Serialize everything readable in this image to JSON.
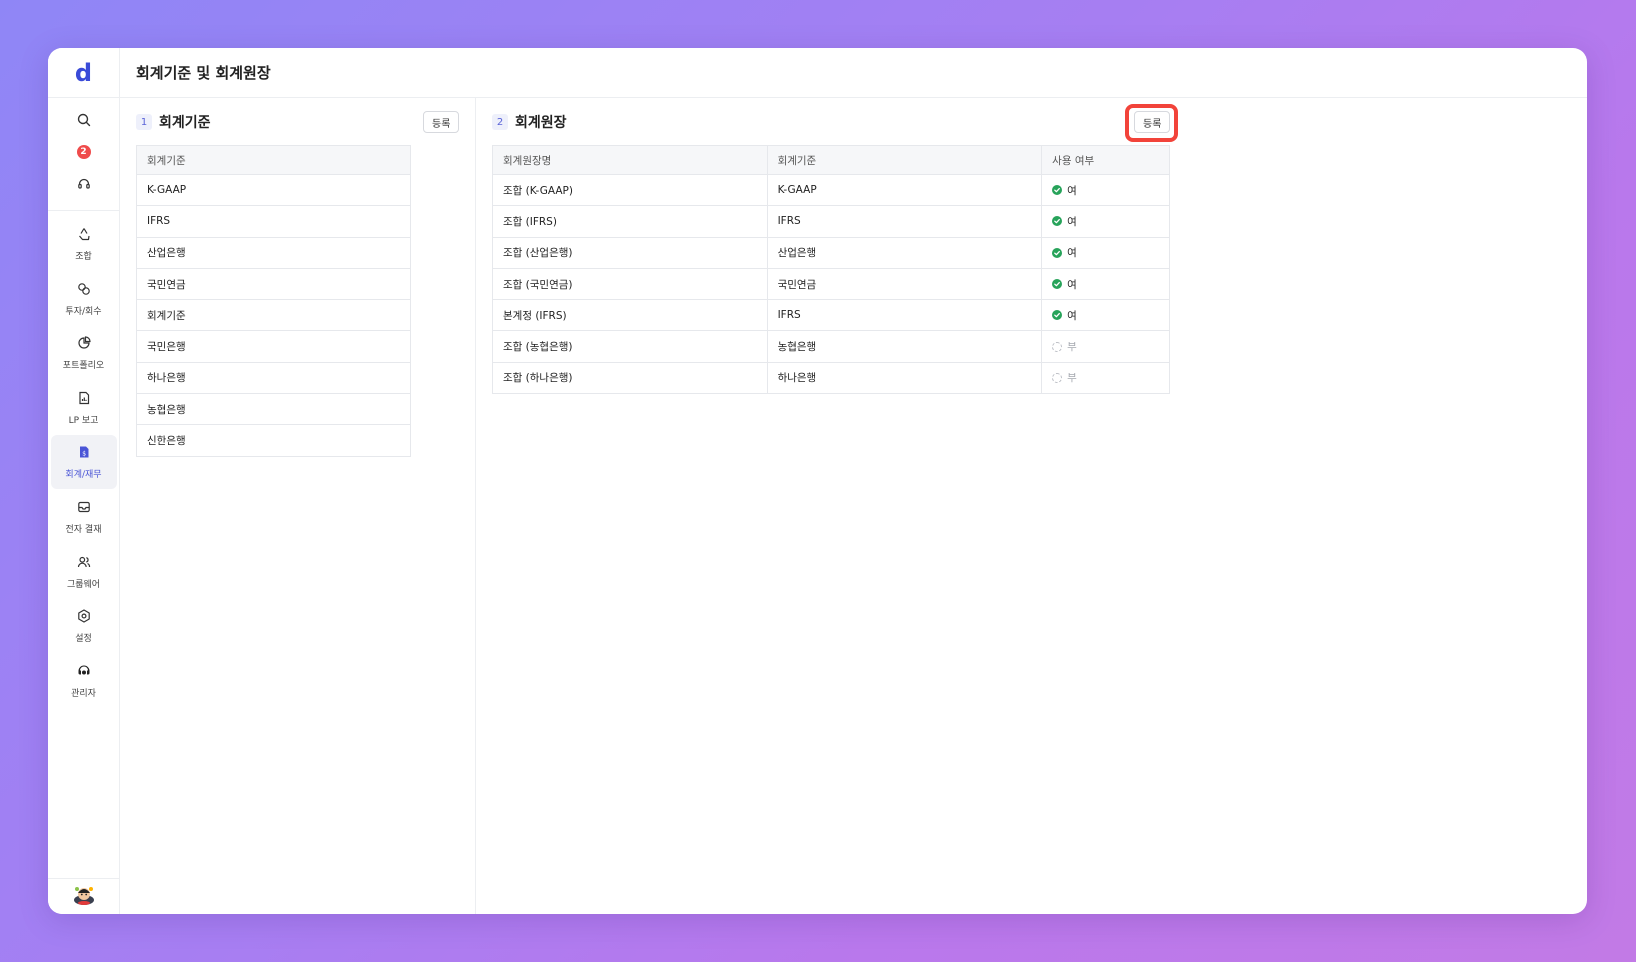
{
  "app": {
    "logo": "d"
  },
  "header": {
    "title": "회계기준 및 회계원장"
  },
  "sidebar": {
    "notification_count": "2",
    "items": [
      {
        "label": "조합",
        "icon": "recycle-icon"
      },
      {
        "label": "투자/회수",
        "icon": "coins-icon"
      },
      {
        "label": "포트폴리오",
        "icon": "pie-chart-icon"
      },
      {
        "label": "LP 보고",
        "icon": "report-icon"
      },
      {
        "label": "회계/재무",
        "icon": "accounting-icon",
        "active": true
      },
      {
        "label": "전자 결재",
        "icon": "inbox-icon"
      },
      {
        "label": "그룹웨어",
        "icon": "users-icon"
      },
      {
        "label": "설정",
        "icon": "settings-icon"
      },
      {
        "label": "관리자",
        "icon": "admin-icon"
      }
    ]
  },
  "standards": {
    "number": "1",
    "title": "회계기준",
    "register_label": "등록",
    "column": "회계기준",
    "rows": [
      "K-GAAP",
      "IFRS",
      "산업은행",
      "국민연금",
      "회계기준",
      "국민은행",
      "하나은행",
      "농협은행",
      "신한은행"
    ]
  },
  "ledgers": {
    "number": "2",
    "title": "회계원장",
    "register_label": "등록",
    "columns": [
      "회계원장명",
      "회계기준",
      "사용 여부"
    ],
    "rows": [
      {
        "name": "조합 (K-GAAP)",
        "standard": "K-GAAP",
        "status": "여",
        "active": true
      },
      {
        "name": "조합 (IFRS)",
        "standard": "IFRS",
        "status": "여",
        "active": true
      },
      {
        "name": "조합 (산업은행)",
        "standard": "산업은행",
        "status": "여",
        "active": true
      },
      {
        "name": "조합 (국민연금)",
        "standard": "국민연금",
        "status": "여",
        "active": true
      },
      {
        "name": "본계정 (IFRS)",
        "standard": "IFRS",
        "status": "여",
        "active": true
      },
      {
        "name": "조합 (농협은행)",
        "standard": "농협은행",
        "status": "부",
        "active": false
      },
      {
        "name": "조합 (하나은행)",
        "standard": "하나은행",
        "status": "부",
        "active": false
      }
    ]
  },
  "colors": {
    "accent": "#4a55d6",
    "highlight": "#f2433a",
    "active_status": "#27a35a"
  }
}
